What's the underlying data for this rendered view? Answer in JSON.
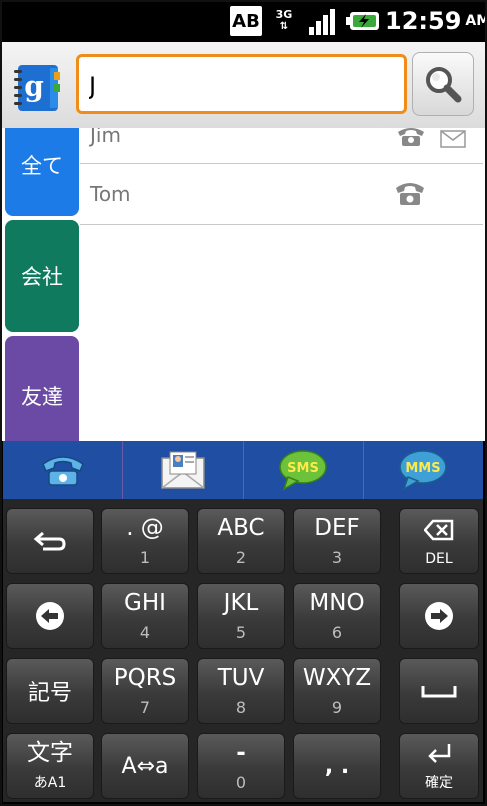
{
  "status_bar": {
    "input_mode": "AB",
    "network": "3G",
    "time": "12:59",
    "ampm": "AM"
  },
  "search": {
    "value": "J",
    "placeholder": ""
  },
  "side_tabs": [
    {
      "label": "全て",
      "color": "#1d7be8"
    },
    {
      "label": "会社",
      "color": "#0f7a5e"
    },
    {
      "label": "友達",
      "color": "#6a4aa5"
    }
  ],
  "contacts": [
    {
      "name": "Jim"
    },
    {
      "name": "Tom"
    }
  ],
  "action_bar": {
    "sms_label": "SMS",
    "mms_label": "MMS"
  },
  "keyboard": {
    "keys": [
      {
        "main": ". @",
        "sub": "1"
      },
      {
        "main": "ABC",
        "sub": "2"
      },
      {
        "main": "DEF",
        "sub": "3"
      },
      {
        "main": "DEL"
      },
      {
        "main": "GHI",
        "sub": "4"
      },
      {
        "main": "JKL",
        "sub": "5"
      },
      {
        "main": "MNO",
        "sub": "6"
      },
      {
        "main": "記号"
      },
      {
        "main": "PQRS",
        "sub": "7"
      },
      {
        "main": "TUV",
        "sub": "8"
      },
      {
        "main": "WXYZ",
        "sub": "9"
      },
      {
        "main": "文字",
        "sub": "あA1"
      },
      {
        "main": "A⇔a"
      },
      {
        "main": "-",
        "sub": "0"
      },
      {
        "main": ",  ."
      },
      {
        "main": "確定"
      }
    ]
  }
}
